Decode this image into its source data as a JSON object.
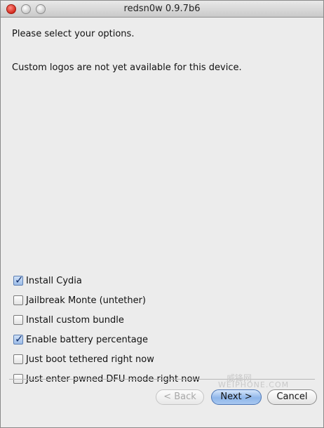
{
  "window": {
    "title": "redsn0w 0.9.7b6"
  },
  "main": {
    "prompt": "Please select your options.",
    "note": "Custom logos are not yet available for this device."
  },
  "options": [
    {
      "label": "Install Cydia",
      "checked": true
    },
    {
      "label": "Jailbreak Monte (untether)",
      "checked": false
    },
    {
      "label": "Install custom bundle",
      "checked": false
    },
    {
      "label": "Enable battery percentage",
      "checked": true
    },
    {
      "label": "Just boot tethered right now",
      "checked": false
    },
    {
      "label": "Just enter pwned DFU mode right now",
      "checked": false
    }
  ],
  "buttons": {
    "back": "< Back",
    "next": "Next >",
    "cancel": "Cancel"
  },
  "watermark": {
    "line1": "威锋网",
    "line2": "WEIPHONE.COM"
  }
}
